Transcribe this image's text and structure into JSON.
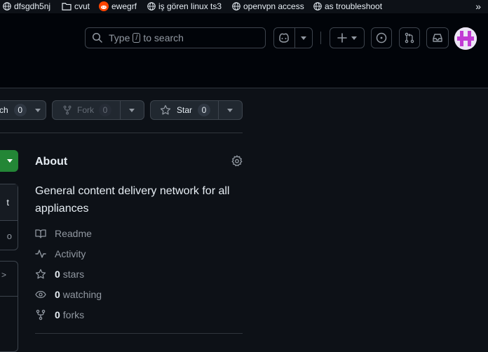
{
  "bookmarks": [
    {
      "label": "dfsgdh5nj",
      "icon": "globe-icon"
    },
    {
      "label": "cvut",
      "icon": "folder-icon"
    },
    {
      "label": "ewegrf",
      "icon": "reddit-icon"
    },
    {
      "label": "iş gören linux ts3",
      "icon": "globe-icon"
    },
    {
      "label": "openvpn access",
      "icon": "globe-icon"
    },
    {
      "label": "as troubleshoot",
      "icon": "globe-icon"
    }
  ],
  "bookmarks_more": "»",
  "search": {
    "prefix": "Type",
    "key": "/",
    "suffix": "to search"
  },
  "repo_actions": {
    "watch_label": "ch",
    "watch_count": "0",
    "fork_label": "Fork",
    "fork_count": "0",
    "star_label": "Star",
    "star_count": "0"
  },
  "left_fragments": {
    "item1": "t",
    "item2": "o",
    "item3": ">"
  },
  "about": {
    "title": "About",
    "description": "General content delivery network for all appliances",
    "readme": "Readme",
    "activity": "Activity",
    "stars_count": "0",
    "stars_label": "stars",
    "watching_count": "0",
    "watching_label": "watching",
    "forks_count": "0",
    "forks_label": "forks"
  },
  "colors": {
    "accent_green": "#238636",
    "background": "#0d1117",
    "header": "#010409"
  }
}
